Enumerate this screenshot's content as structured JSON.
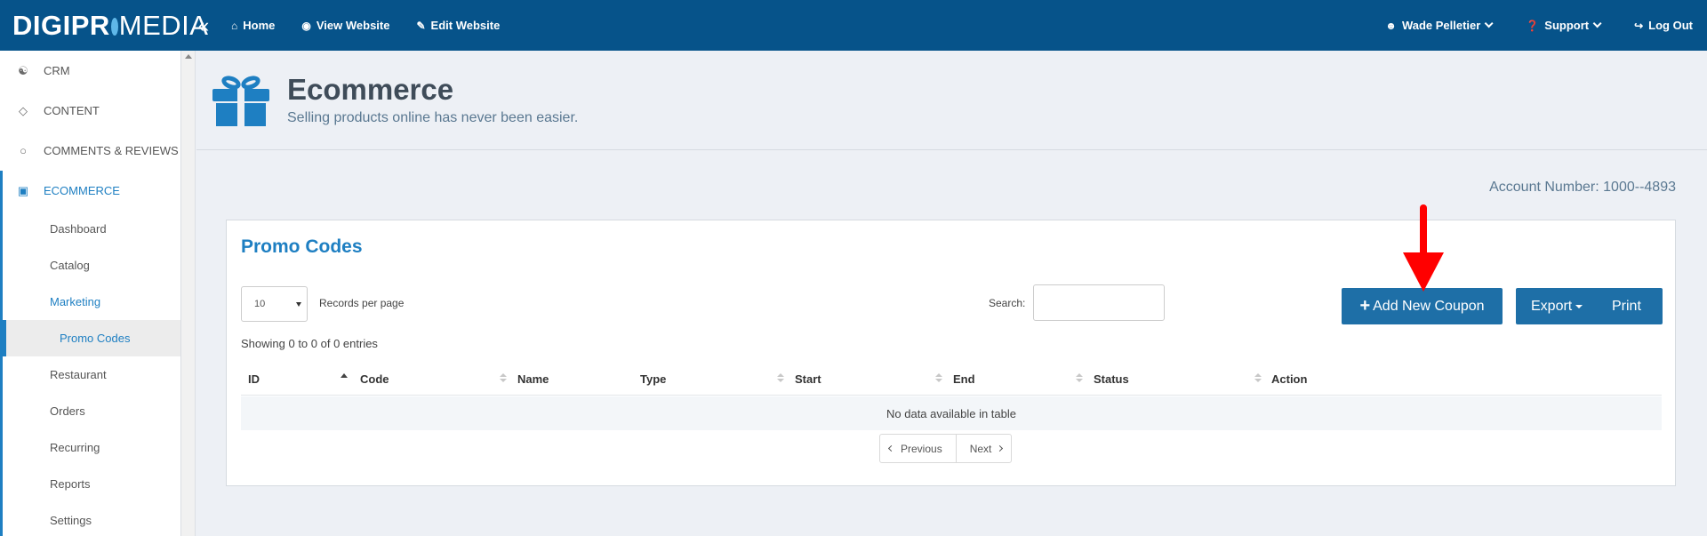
{
  "brand": {
    "part1": "DIGIPR",
    "part2": "MEDIA"
  },
  "topnav": {
    "home": "Home",
    "view_website": "View Website",
    "edit_website": "Edit Website",
    "user": "Wade Pelletier",
    "support": "Support",
    "logout": "Log Out"
  },
  "sidebar": {
    "crm": "CRM",
    "content": "CONTENT",
    "comments": "COMMENTS & REVIEWS",
    "ecommerce": "ECOMMERCE",
    "sub": {
      "dashboard": "Dashboard",
      "catalog": "Catalog",
      "marketing": "Marketing",
      "promo_codes": "Promo Codes",
      "restaurant": "Restaurant",
      "orders": "Orders",
      "recurring": "Recurring",
      "reports": "Reports",
      "settings": "Settings"
    }
  },
  "header": {
    "title": "Ecommerce",
    "subtitle": "Selling products online has never been easier."
  },
  "account_number": "Account Number: 1000--4893",
  "panel": {
    "title": "Promo Codes",
    "page_length": "10",
    "records_label": "Records per page",
    "search_label": "Search:",
    "search_value": "",
    "add_button": "Add New Coupon",
    "export_button": "Export",
    "print_button": "Print",
    "showing": "Showing 0 to 0 of 0 entries",
    "columns": {
      "id": "ID",
      "code": "Code",
      "name": "Name",
      "type": "Type",
      "start": "Start",
      "end": "End",
      "status": "Status",
      "action": "Action"
    },
    "empty": "No data available in table",
    "prev": "Previous",
    "next": "Next"
  },
  "colors": {
    "navbar": "#06538a",
    "accent": "#1e7fc2",
    "button": "#1e6fa7",
    "annotation_arrow": "#ff0000"
  },
  "icons": [
    "collapse-icon",
    "home-icon",
    "eye-icon",
    "edit-icon",
    "user-icon",
    "question-icon",
    "logout-icon",
    "users-icon",
    "diamond-icon",
    "comment-icon",
    "gift-icon",
    "plus-icon"
  ]
}
